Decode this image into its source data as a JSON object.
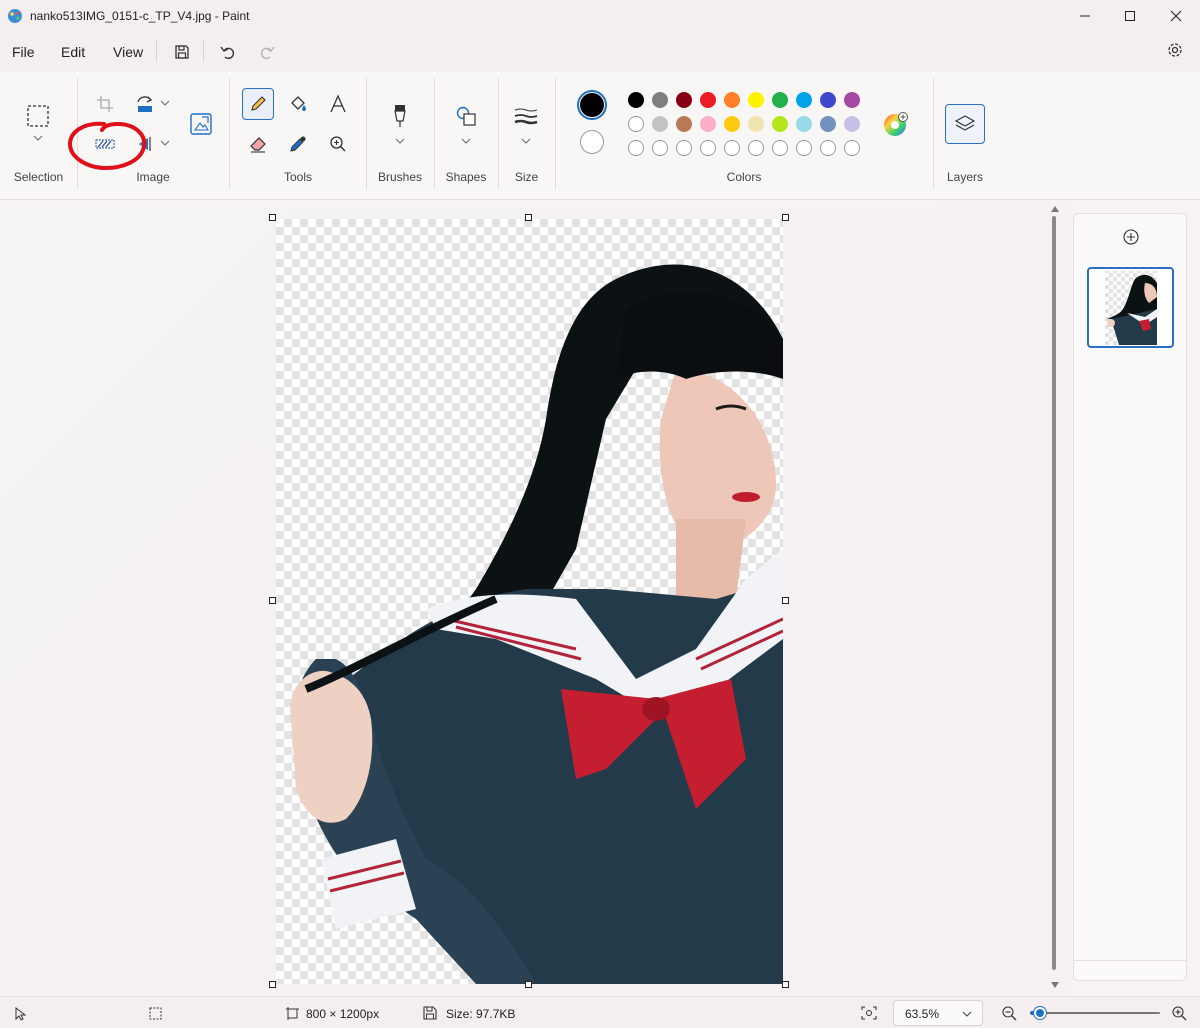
{
  "window": {
    "title": "nanko513IMG_0151-c_TP_V4.jpg - Paint",
    "controls": [
      "minimize-icon",
      "maximize-icon",
      "close-icon"
    ]
  },
  "menu": {
    "items": [
      {
        "label": "File"
      },
      {
        "label": "Edit"
      },
      {
        "label": "View"
      }
    ],
    "quick_actions": [
      "save-icon",
      "undo-icon",
      "redo-icon"
    ],
    "settings_icon": "gear-icon"
  },
  "ribbon": {
    "groups": {
      "selection": "Selection",
      "image": "Image",
      "tools": "Tools",
      "brushes": "Brushes",
      "shapes": "Shapes",
      "size": "Size",
      "colors": "Colors",
      "layers": "Layers"
    },
    "image_tools": [
      "crop-icon",
      "rotate-icon",
      "remove-background-icon",
      "flip-icon",
      "resize-icon"
    ],
    "tools": [
      "pencil-icon",
      "fill-icon",
      "text-icon",
      "eraser-icon",
      "color-picker-icon",
      "magnifier-icon"
    ],
    "active_tool": "pencil-icon",
    "annotation": "red hand-drawn circle around remove-background tool",
    "colors": {
      "primary": "#000000",
      "secondary": "#ffffff",
      "row1": [
        "#000000",
        "#7f7f7f",
        "#880015",
        "#ed1c24",
        "#ff7f27",
        "#fff200",
        "#22b14c",
        "#00a2e8",
        "#3f48cc",
        "#a349a4"
      ],
      "row2": [
        "#ffffff",
        "#c3c3c3",
        "#b97a57",
        "#ffaec9",
        "#ffc90e",
        "#efe4b0",
        "#b5e61d",
        "#99d9ea",
        "#7092be",
        "#c8bfe7"
      ],
      "row3": [
        "",
        "",
        "",
        "",
        "",
        "",
        "",
        "",
        "",
        ""
      ],
      "edit_colors_icon": "color-wheel-icon"
    }
  },
  "status": {
    "dimensions": "800 × 1200px",
    "size": "Size: 97.7KB",
    "zoom": "63.5%",
    "zoom_fraction": 0.08
  },
  "layers": {
    "add_icon": "add-layer-icon"
  }
}
